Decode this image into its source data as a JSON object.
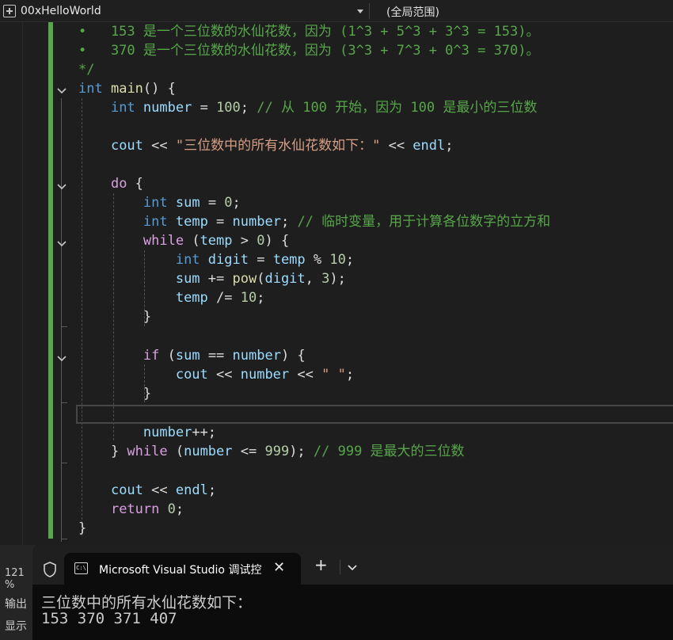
{
  "navbar": {
    "project": "00xHelloWorld",
    "scope": "(全局范围)"
  },
  "editor": {
    "comment_line_1": "•   153 是一个三位数的水仙花数，因为 (1^3 + 5^3 + 3^3 = 153)。",
    "comment_line_2": "•   370 是一个三位数的水仙花数，因为 (3^3 + 7^3 + 0^3 = 370)。",
    "comment_end": "*/"
  },
  "status": {
    "zoom": "121 %"
  },
  "bottom_panel": {
    "output_label": "输出",
    "show_label": "显示"
  },
  "console": {
    "tab_title": "Microsoft Visual Studio 调试控",
    "tab_icon_text": "C:\\",
    "output": [
      "三位数中的所有水仙花数如下：",
      "153 370 371 407"
    ]
  },
  "colors": {
    "change_bar": "#57a64a",
    "keyword": "#569cd6",
    "control_keyword": "#d8a0df",
    "comment": "#57a64a",
    "string": "#d69d85",
    "number": "#b5cea8",
    "function": "#dcdcaa",
    "identifier": "#9cdcfe"
  }
}
